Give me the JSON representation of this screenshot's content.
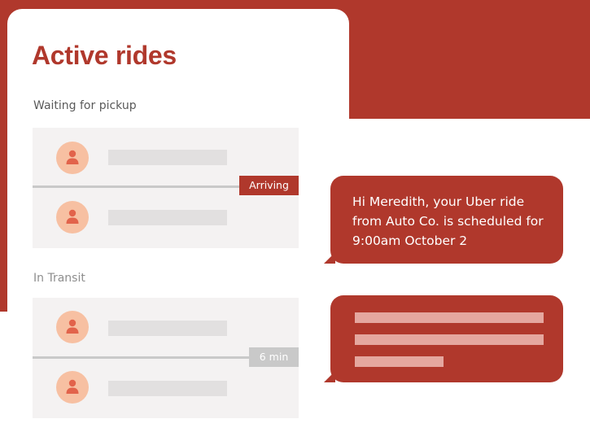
{
  "rides_panel": {
    "title": "Active rides",
    "sections": [
      {
        "label": "Waiting for pickup",
        "badge": "Arriving",
        "badge_color": "#b0382c",
        "riders": [
          {
            "icon": "person-icon"
          },
          {
            "icon": "person-icon"
          }
        ]
      },
      {
        "label": "In Transit",
        "badge": "6 min",
        "badge_color": "#c9c9c9",
        "riders": [
          {
            "icon": "person-icon"
          },
          {
            "icon": "person-icon"
          }
        ]
      }
    ]
  },
  "messages": [
    {
      "text": "Hi Meredith, your Uber ride from Auto Co. is scheduled for 9:00am October 2"
    },
    {
      "text": ""
    }
  ],
  "colors": {
    "brand_red": "#b0382c",
    "avatar_peach": "#f7c0a2",
    "avatar_icon": "#e2634b",
    "row_bg": "#f4f2f2",
    "placeholder": "#e2e0e0"
  }
}
